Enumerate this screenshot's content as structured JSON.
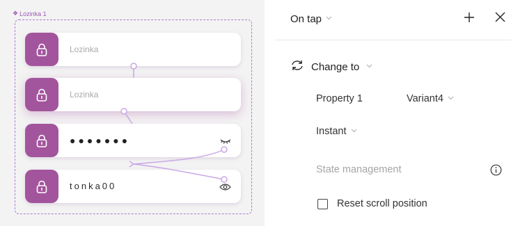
{
  "canvas": {
    "frame_label": "Lozinka 1",
    "fields": [
      {
        "text": "Lozinka"
      },
      {
        "text": "Lozinka"
      },
      {
        "text": "●●●●●●●"
      },
      {
        "text": "tonka00"
      }
    ]
  },
  "panel": {
    "trigger_label": "On tap",
    "action_label": "Change to",
    "property_name": "Property 1",
    "property_value": "Variant4",
    "animation_label": "Instant",
    "state_management_label": "State management",
    "reset_scroll_label": "Reset scroll position",
    "reset_scroll_checked": false
  },
  "colors": {
    "accent": "#a2559c",
    "frame_dash": "#a67bd0",
    "wire": "#c9a6e6"
  },
  "icons": [
    "component-diamond-icon",
    "lock-icon",
    "eye-closed-icon",
    "eye-icon",
    "plus-icon",
    "close-icon",
    "swap-arrows-icon",
    "chevron-down-icon",
    "info-icon"
  ]
}
